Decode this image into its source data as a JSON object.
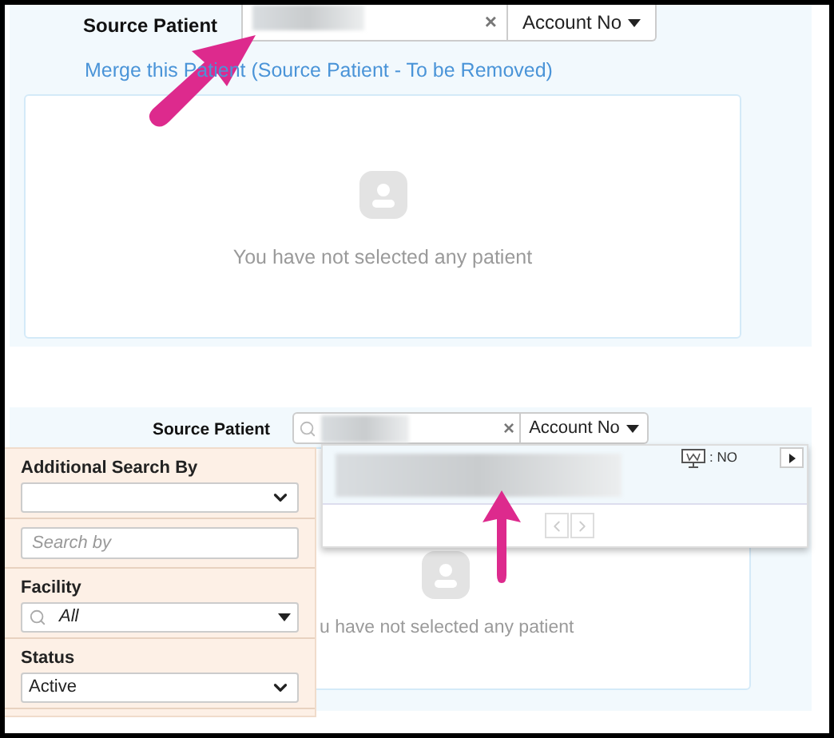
{
  "top_form": {
    "label": "Source Patient",
    "search_mode": "Account No",
    "clear": "×",
    "link": "Merge this Patient (Source Patient - To be Removed)",
    "empty_message": "You have not selected any patient"
  },
  "bottom_form": {
    "label": "Source Patient",
    "search_mode": "Account No",
    "clear": "×",
    "empty_message": "u have not selected any patient"
  },
  "results": {
    "status": ": NO"
  },
  "filters": [
    {
      "kind": "select",
      "label": "Additional Search By"
    },
    {
      "kind": "input",
      "placeholder": "Search by"
    },
    {
      "kind": "combo",
      "label": "Facility",
      "value": "All"
    },
    {
      "kind": "select",
      "label": "Status",
      "value": "Active"
    }
  ]
}
